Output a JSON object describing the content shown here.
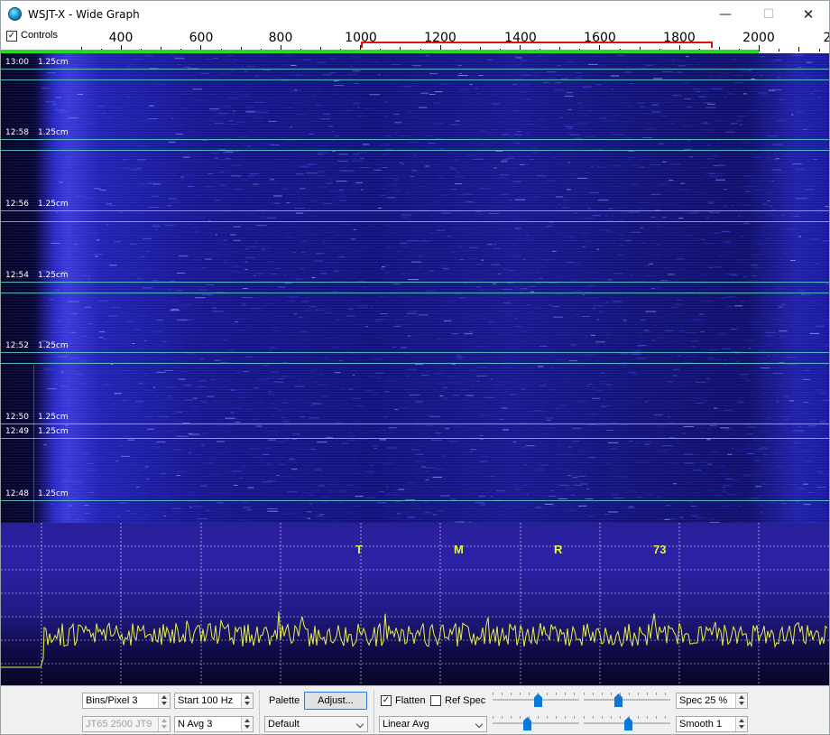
{
  "window": {
    "title": "WSJT-X - Wide Graph"
  },
  "titlebar": {
    "minimize_glyph": "—",
    "maximize_glyph": "☐",
    "close_glyph": "✕"
  },
  "ruler": {
    "controls_checked": true,
    "controls_label": "Controls",
    "tick_labels": [
      "400",
      "600",
      "800",
      "1000",
      "1200",
      "1400",
      "1600",
      "1800",
      "2000",
      "2"
    ]
  },
  "waterfall": {
    "timestamps": [
      {
        "time": "13:00",
        "interval": "1.25cm"
      },
      {
        "time": "12:58",
        "interval": "1.25cm"
      },
      {
        "time": "12:56",
        "interval": "1.25cm"
      },
      {
        "time": "12:54",
        "interval": "1.25cm"
      },
      {
        "time": "12:52",
        "interval": "1.25cm"
      },
      {
        "time": "12:50",
        "interval": "1.25cm"
      },
      {
        "time": "12:49",
        "interval": "1.25cm"
      },
      {
        "time": "12:48",
        "interval": "1.25cm"
      }
    ]
  },
  "spectrum": {
    "submode_labels": [
      "T",
      "M",
      "R",
      "73"
    ],
    "trace_color": "#e8f04a"
  },
  "controls": {
    "bins_per_pixel": "Bins/Pixel  3",
    "start": "Start 100 Hz",
    "mode_display": "JT65  2500  JT9",
    "n_avg": "N Avg 3",
    "palette_label": "Palette",
    "adjust_button": "Adjust...",
    "palette_value": "Default",
    "flatten_label": "Flatten",
    "flatten_checked": true,
    "ref_spec_label": "Ref Spec",
    "ref_spec_checked": false,
    "avg_mode": "Linear Avg",
    "spec": "Spec 25 %",
    "smooth": "Smooth  1"
  },
  "colors": {
    "accent_red": "#e01010",
    "ruler_green": "#22dd22",
    "slider_blue": "#0a78d7"
  }
}
